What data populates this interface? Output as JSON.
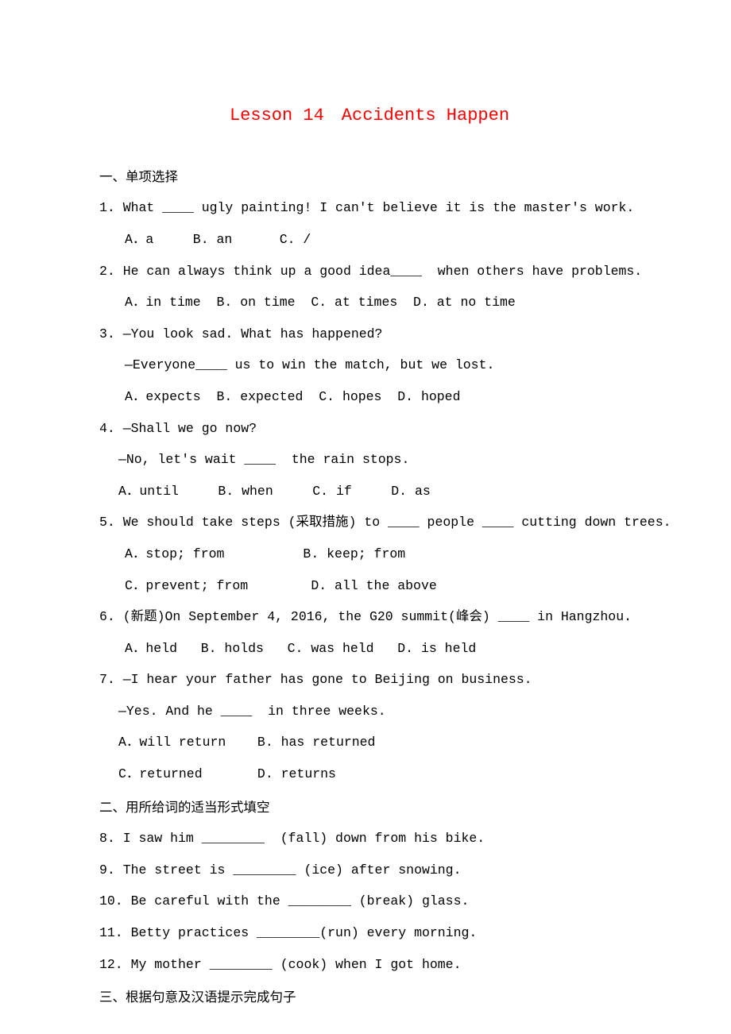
{
  "title": "Lesson 14　Accidents Happen",
  "sections": {
    "s1": {
      "heading": "一、单项选择",
      "q1": "1. What ____ ugly painting! I can't believe it is the master's work.",
      "q1opts": "A．a     B. an      C. /",
      "q2": "2. He can always think up a good idea____  when others have problems.",
      "q2opts": "A．in time  B. on time  C. at times  D. at no time",
      "q3a": "3. —You look sad. What has happened?",
      "q3b": "—Everyone____ us to win the match, but we lost.",
      "q3opts": "A．expects  B. expected  C. hopes  D. hoped",
      "q4a": "4. —Shall we go now?",
      "q4b": "—No, let's wait ____  the rain stops.",
      "q4opts": "A．until     B. when     C. if     D. as",
      "q5": "5. We should take steps (采取措施) to ____ people ____ cutting down trees.",
      "q5optsA": "A．stop; from          B. keep; from",
      "q5optsB": "C．prevent; from        D. all the above",
      "q6": "6. (新题)On September 4, 2016, the G20 summit(峰会) ____ in Hangzhou.",
      "q6opts": "A．held   B. holds   C. was held   D. is held",
      "q7a": "7. —I hear your father has gone to Beijing on business.",
      "q7b": "—Yes. And he ____  in three weeks.",
      "q7optsA": "A．will return    B. has returned",
      "q7optsB": "C．returned       D. returns"
    },
    "s2": {
      "heading": "二、用所给词的适当形式填空",
      "q8": "8. I saw him ________  (fall) down from his bike.",
      "q9": "9. The street is ________ (ice) after snowing.",
      "q10": "10. Be careful with the ________ (break) glass.",
      "q11": "11. Betty practices ________(run) every morning.",
      "q12": "12. My mother ________ (cook) when I got home."
    },
    "s3": {
      "heading": "三、根据句意及汉语提示完成句子"
    }
  }
}
